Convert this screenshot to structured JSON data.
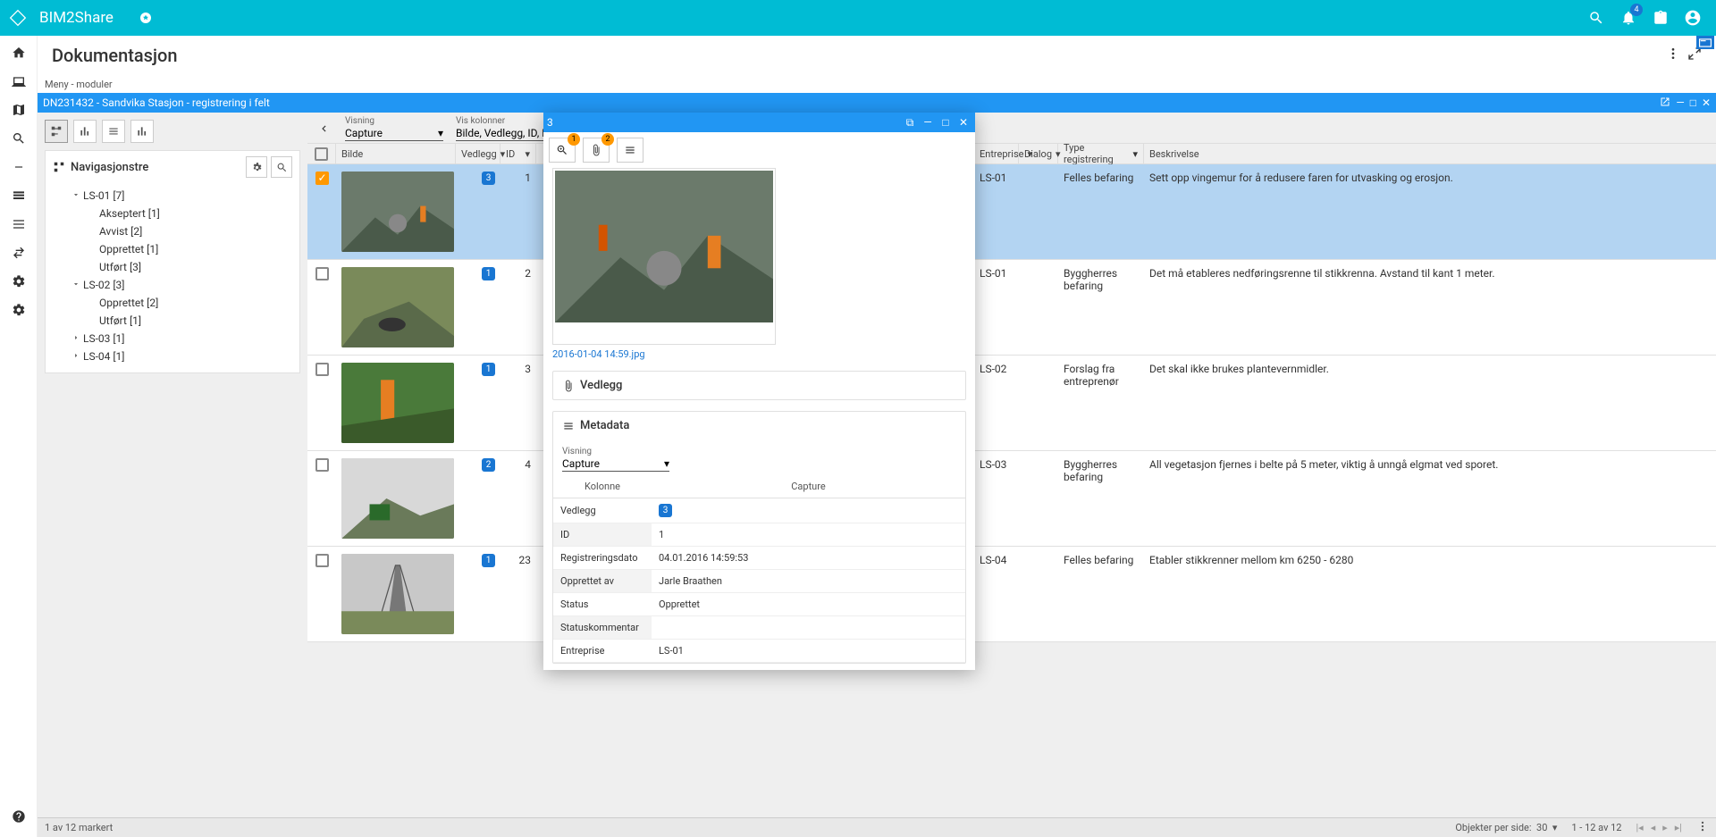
{
  "brand": "BIM2Share",
  "notif_count": "4",
  "page_title": "Dokumentasjon",
  "menu_label": "Meny - moduler",
  "project_title": "DN231432 - Sandvika Stasjon - registrering i felt",
  "tree_title": "Navigasjonstre",
  "tree": [
    {
      "label": "LS-01 [7]",
      "expand": "v",
      "depth": 1
    },
    {
      "label": "Akseptert [1]",
      "expand": "",
      "depth": 2
    },
    {
      "label": "Avvist [2]",
      "expand": "",
      "depth": 2
    },
    {
      "label": "Opprettet [1]",
      "expand": "",
      "depth": 2
    },
    {
      "label": "Utført [3]",
      "expand": "",
      "depth": 2
    },
    {
      "label": "LS-02 [3]",
      "expand": "v",
      "depth": 1
    },
    {
      "label": "Opprettet [2]",
      "expand": "",
      "depth": 2
    },
    {
      "label": "Utført [1]",
      "expand": "",
      "depth": 2
    },
    {
      "label": "LS-03 [1]",
      "expand": ">",
      "depth": 1
    },
    {
      "label": "LS-04 [1]",
      "expand": ">",
      "depth": 1
    }
  ],
  "filters": {
    "visning_label": "Visning",
    "visning_value": "Capture",
    "kolonner_label": "Vis kolonner",
    "kolonner_value": "Bilde, Vedlegg, ID, Regist..."
  },
  "columns": [
    "Bilde",
    "Vedlegg",
    "ID",
    "Entreprise",
    "Dialog",
    "Type registrering",
    "Beskrivelse"
  ],
  "rows": [
    {
      "selected": true,
      "v": "3",
      "id": "1",
      "ent": "LS-01",
      "dialog": "",
      "type": "Felles befaring",
      "desc": "Sett opp vingemur for å redusere faren for utvasking og erosjon."
    },
    {
      "selected": false,
      "v": "1",
      "id": "2",
      "ent": "LS-01",
      "dialog": "",
      "type": "Byggherres befaring",
      "desc": "Det må etableres nedføringsrenne til stikkrenna. Avstand til kant 1 meter."
    },
    {
      "selected": false,
      "v": "1",
      "id": "3",
      "ent": "LS-02",
      "dialog": "",
      "type": "Forslag fra entreprenør",
      "desc": "Det skal ikke brukes plantevernmidler."
    },
    {
      "selected": false,
      "v": "2",
      "id": "4",
      "ent": "LS-03",
      "dialog": "",
      "type": "Byggherres befaring",
      "desc": "All vegetasjon fjernes i belte på 5 meter, viktig å unngå elgmat ved sporet."
    },
    {
      "selected": false,
      "v": "1",
      "id": "23",
      "ent": "LS-04",
      "dialog": "",
      "type": "Felles befaring",
      "desc": "Etabler stikkrenner mellom km 6250 - 6280"
    }
  ],
  "footer": {
    "left": "1 av 12 markert",
    "perpage_label": "Objekter per side:",
    "perpage_value": "30",
    "range": "1 - 12 av 12"
  },
  "dialog": {
    "title": "3",
    "badge_zoom": "1",
    "badge_attach": "2",
    "image_name": "2016-01-04 14:59.jpg",
    "sec_vedlegg": "Vedlegg",
    "sec_metadata": "Metadata",
    "visning_label": "Visning",
    "visning_value": "Capture",
    "col_h1": "Kolonne",
    "col_h2": "Capture",
    "meta": [
      {
        "k": "Vedlegg",
        "v": "3",
        "badge": true
      },
      {
        "k": "ID",
        "v": "1"
      },
      {
        "k": "Registreringsdato",
        "v": "04.01.2016 14:59:53"
      },
      {
        "k": "Opprettet av",
        "v": "Jarle Braathen"
      },
      {
        "k": "Status",
        "v": "Opprettet"
      },
      {
        "k": "Statuskommentar",
        "v": ""
      },
      {
        "k": "Entreprise",
        "v": "LS-01"
      }
    ]
  }
}
